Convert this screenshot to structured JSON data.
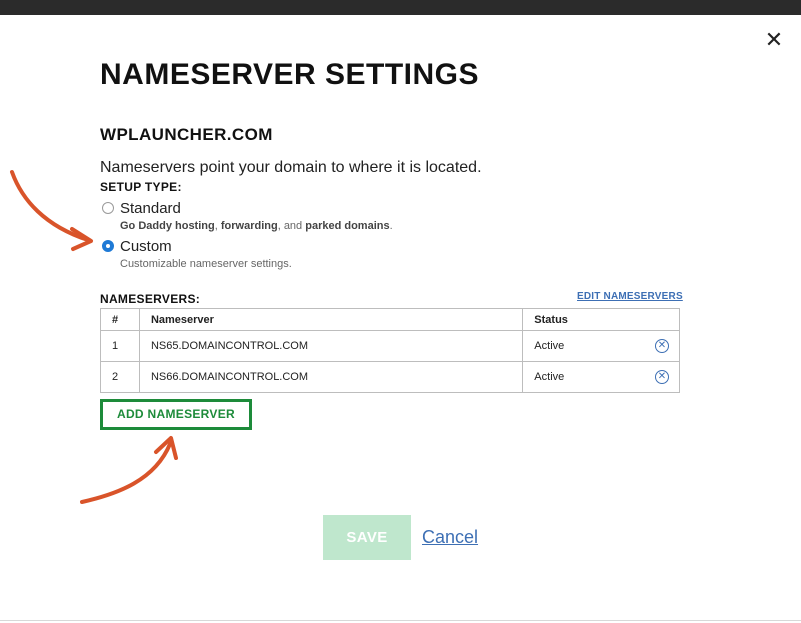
{
  "modal": {
    "close_glyph": "✕",
    "title": "NAMESERVER SETTINGS",
    "domain": "WPLAUNCHER.COM",
    "description": "Nameservers point your domain to where it is located.",
    "setup_type_label": "SETUP TYPE:",
    "options": [
      {
        "label": "Standard",
        "checked": false,
        "help": {
          "part1": "Go Daddy hosting",
          "sep1": ", ",
          "part2": "forwarding",
          "sep2": ", and ",
          "part3": "parked domains",
          "end": "."
        }
      },
      {
        "label": "Custom",
        "checked": true,
        "help_text": "Customizable nameserver settings."
      }
    ],
    "nameservers_label": "NAMESERVERS:",
    "edit_link": "EDIT NAMESERVERS",
    "table": {
      "headers": [
        "#",
        "Nameserver",
        "Status"
      ],
      "rows": [
        {
          "num": "1",
          "nameserver": "NS65.DOMAINCONTROL.COM",
          "status": "Active"
        },
        {
          "num": "2",
          "nameserver": "NS66.DOMAINCONTROL.COM",
          "status": "Active"
        }
      ],
      "remove_glyph": "✕"
    },
    "add_button": "ADD NAMESERVER",
    "save_button": "SAVE",
    "cancel_link": "Cancel"
  },
  "colors": {
    "accent_green": "#1d8b3a",
    "link_blue": "#3d6fb4",
    "radio_blue": "#1f7ad6",
    "save_disabled": "#bfe7cd",
    "annotation_arrow": "#d9542a"
  },
  "icons": {
    "close": "close-icon",
    "remove": "remove-circle-icon",
    "annotation": "annotation-arrow"
  }
}
